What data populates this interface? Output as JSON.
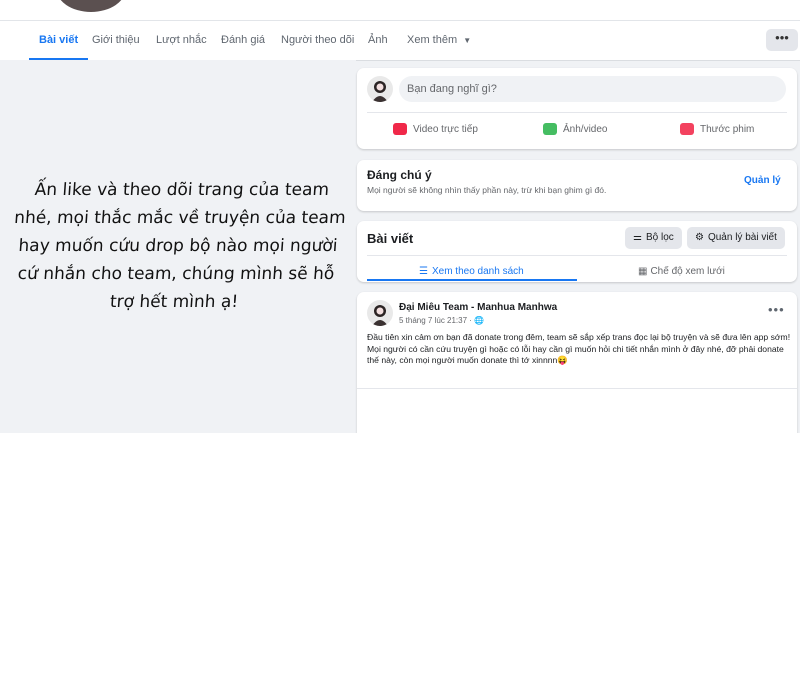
{
  "nav": {
    "tabs": [
      {
        "label": "Bài viết"
      },
      {
        "label": "Giới thiệu"
      },
      {
        "label": "Lượt nhắc"
      },
      {
        "label": "Đánh giá"
      },
      {
        "label": "Người theo dõi"
      },
      {
        "label": "Ảnh"
      },
      {
        "label": "Xem thêm"
      }
    ],
    "active_tab": "Bài viết",
    "more_button": "•••"
  },
  "promo_text": "Ấn like và theo dõi trang của team nhé, mọi thắc mắc về truyện của team hay muốn cứu drop bộ nào mọi người cứ nhắn cho team, chúng mình sẽ hỗ trợ hết mình ạ!",
  "composer": {
    "placeholder": "Bạn đang nghĩ gì?",
    "actions": [
      {
        "label": "Video trực tiếp",
        "icon": "live-video-icon",
        "color": "#f02849"
      },
      {
        "label": "Ảnh/video",
        "icon": "photo-icon",
        "color": "#45bd62"
      },
      {
        "label": "Thước phim",
        "icon": "reels-icon",
        "color": "#f3425f"
      }
    ]
  },
  "notice": {
    "title": "Đáng chú ý",
    "subtitle": "Mọi người sẽ không nhìn thấy phần này, trừ khi bạn ghim gì đó.",
    "manage_link": "Quản lý"
  },
  "posts_header": {
    "title": "Bài viết",
    "filter_button": "Bộ lọc",
    "manage_button": "Quản lý bài viết",
    "view_tabs": [
      {
        "label": "Xem theo danh sách"
      },
      {
        "label": "Chế độ xem lưới"
      }
    ]
  },
  "post": {
    "author": "Đại Miêu Team - Manhua Manhwa",
    "time": "5 tháng 7 lúc 21:37 · ",
    "text_lines": [
      "Đầu tiên xin cảm ơn bạn đã donate trong đêm, team sẽ sắp xếp trans đọc lại bộ truyện và sẽ đưa lên app sớm!",
      "Mọi người có cần cứu truyện gì hoặc có lỗi hay cần gì muốn hỏi chi tiết nhắn mình ở đây nhé, đỡ phải donate thế này, còn mọi người muốn donate thì tớ xinnnn😝"
    ],
    "menu": "•••"
  },
  "colors": {
    "accent": "#1877f2",
    "page_bg": "#f0f2f5",
    "card_bg": "#ffffff"
  }
}
